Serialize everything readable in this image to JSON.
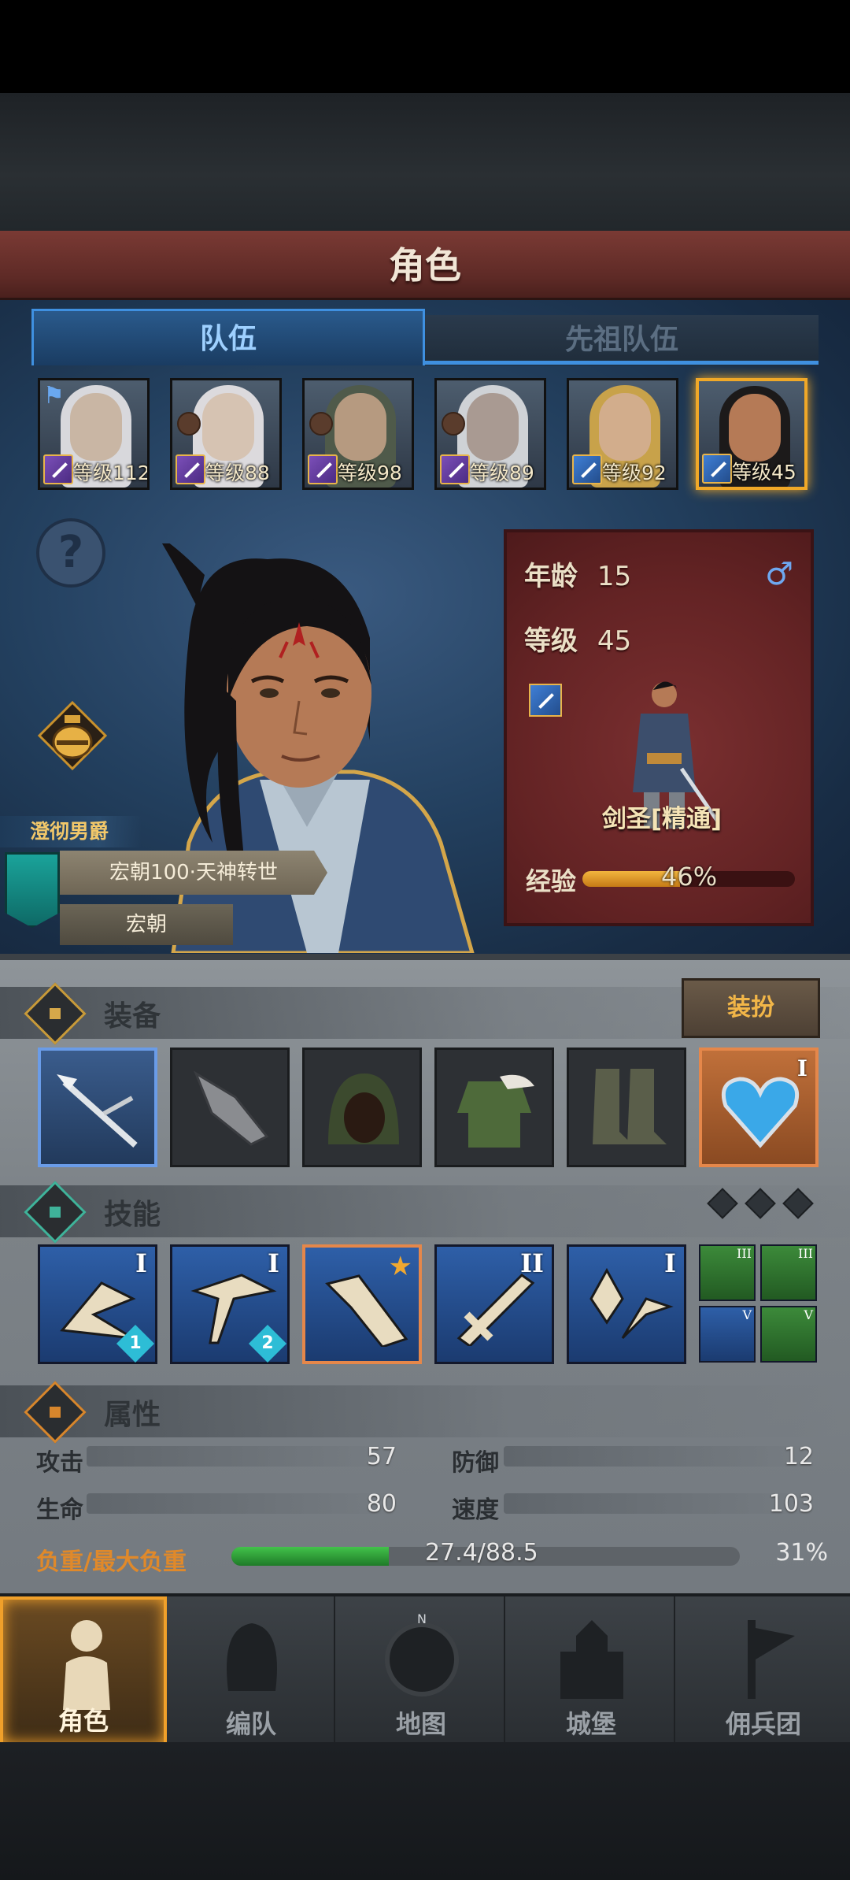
{
  "header": {
    "title": "角色"
  },
  "tabs": [
    {
      "label": "队伍",
      "active": true
    },
    {
      "label": "先祖队伍",
      "active": false
    }
  ],
  "party": [
    {
      "level_text": "等级112",
      "class": "magic",
      "flag": true,
      "hair": "#d8d8dc",
      "skin": "#c9b6a4",
      "selected": false
    },
    {
      "level_text": "等级88",
      "class": "magic",
      "flag": false,
      "hair": "#dcdadd",
      "skin": "#d6c3b2",
      "selected": false
    },
    {
      "level_text": "等级98",
      "class": "magic",
      "flag": false,
      "hair": "#4f5a4a",
      "skin": "#b69a80",
      "selected": false
    },
    {
      "level_text": "等级89",
      "class": "magic",
      "flag": false,
      "hair": "#cfd2d6",
      "skin": "#a99a92",
      "selected": false
    },
    {
      "level_text": "等级92",
      "class": "sword",
      "flag": false,
      "hair": "#c8a24a",
      "skin": "#d2ad8c",
      "selected": false
    },
    {
      "level_text": "等级45",
      "class": "sword",
      "flag": false,
      "hair": "#1c1a1a",
      "skin": "#b57a56",
      "selected": true
    }
  ],
  "hero": {
    "title": "澄彻男爵",
    "guild": "宏朝100·天神转世",
    "guild_short": "宏朝",
    "age_label": "年龄",
    "age": "15",
    "gender_symbol": "♂",
    "level_label": "等级",
    "level": "45",
    "class_name": "剑圣[精通]",
    "exp_label": "经验",
    "exp_percent_text": "46%",
    "exp_fraction": 0.46
  },
  "equipment": {
    "title": "装备",
    "dress_button": "装扮",
    "slots": [
      {
        "name": "weapon-slot",
        "style": "blue",
        "roman": ""
      },
      {
        "name": "gauntlet-slot",
        "style": "dark",
        "roman": ""
      },
      {
        "name": "hood-slot",
        "style": "dark",
        "roman": ""
      },
      {
        "name": "armor-slot",
        "style": "dark",
        "roman": ""
      },
      {
        "name": "boots-slot",
        "style": "dark",
        "roman": ""
      },
      {
        "name": "amulet-slot",
        "style": "orange",
        "roman": "I"
      }
    ]
  },
  "skills": {
    "title": "技能",
    "items": [
      {
        "roman": "I",
        "num": "1",
        "star": false,
        "highlight": false
      },
      {
        "roman": "I",
        "num": "2",
        "star": false,
        "highlight": false
      },
      {
        "roman": "",
        "num": "",
        "star": true,
        "highlight": true
      },
      {
        "roman": "II",
        "num": "",
        "star": false,
        "highlight": false
      },
      {
        "roman": "I",
        "num": "",
        "star": false,
        "highlight": false
      }
    ],
    "passives": [
      {
        "roman": "III",
        "color": "green"
      },
      {
        "roman": "III",
        "color": "green"
      },
      {
        "roman": "V",
        "color": "blue"
      },
      {
        "roman": "V",
        "color": "green"
      }
    ]
  },
  "attributes": {
    "title": "属性",
    "attack_label": "攻击",
    "attack": "57",
    "defense_label": "防御",
    "defense": "12",
    "hp_label": "生命",
    "hp": "80",
    "speed_label": "速度",
    "speed": "103",
    "load_label": "负重/最大负重",
    "load_text": "27.4/88.5",
    "load_percent_text": "31%",
    "load_fraction": 0.31
  },
  "nav": [
    {
      "label": "角色",
      "active": true
    },
    {
      "label": "编队",
      "active": false
    },
    {
      "label": "地图",
      "active": false
    },
    {
      "label": "城堡",
      "active": false
    },
    {
      "label": "佣兵团",
      "active": false
    }
  ],
  "colors": {
    "accent": "#f0a02a",
    "tab_active": "#3f90e0",
    "card": "#632324"
  }
}
